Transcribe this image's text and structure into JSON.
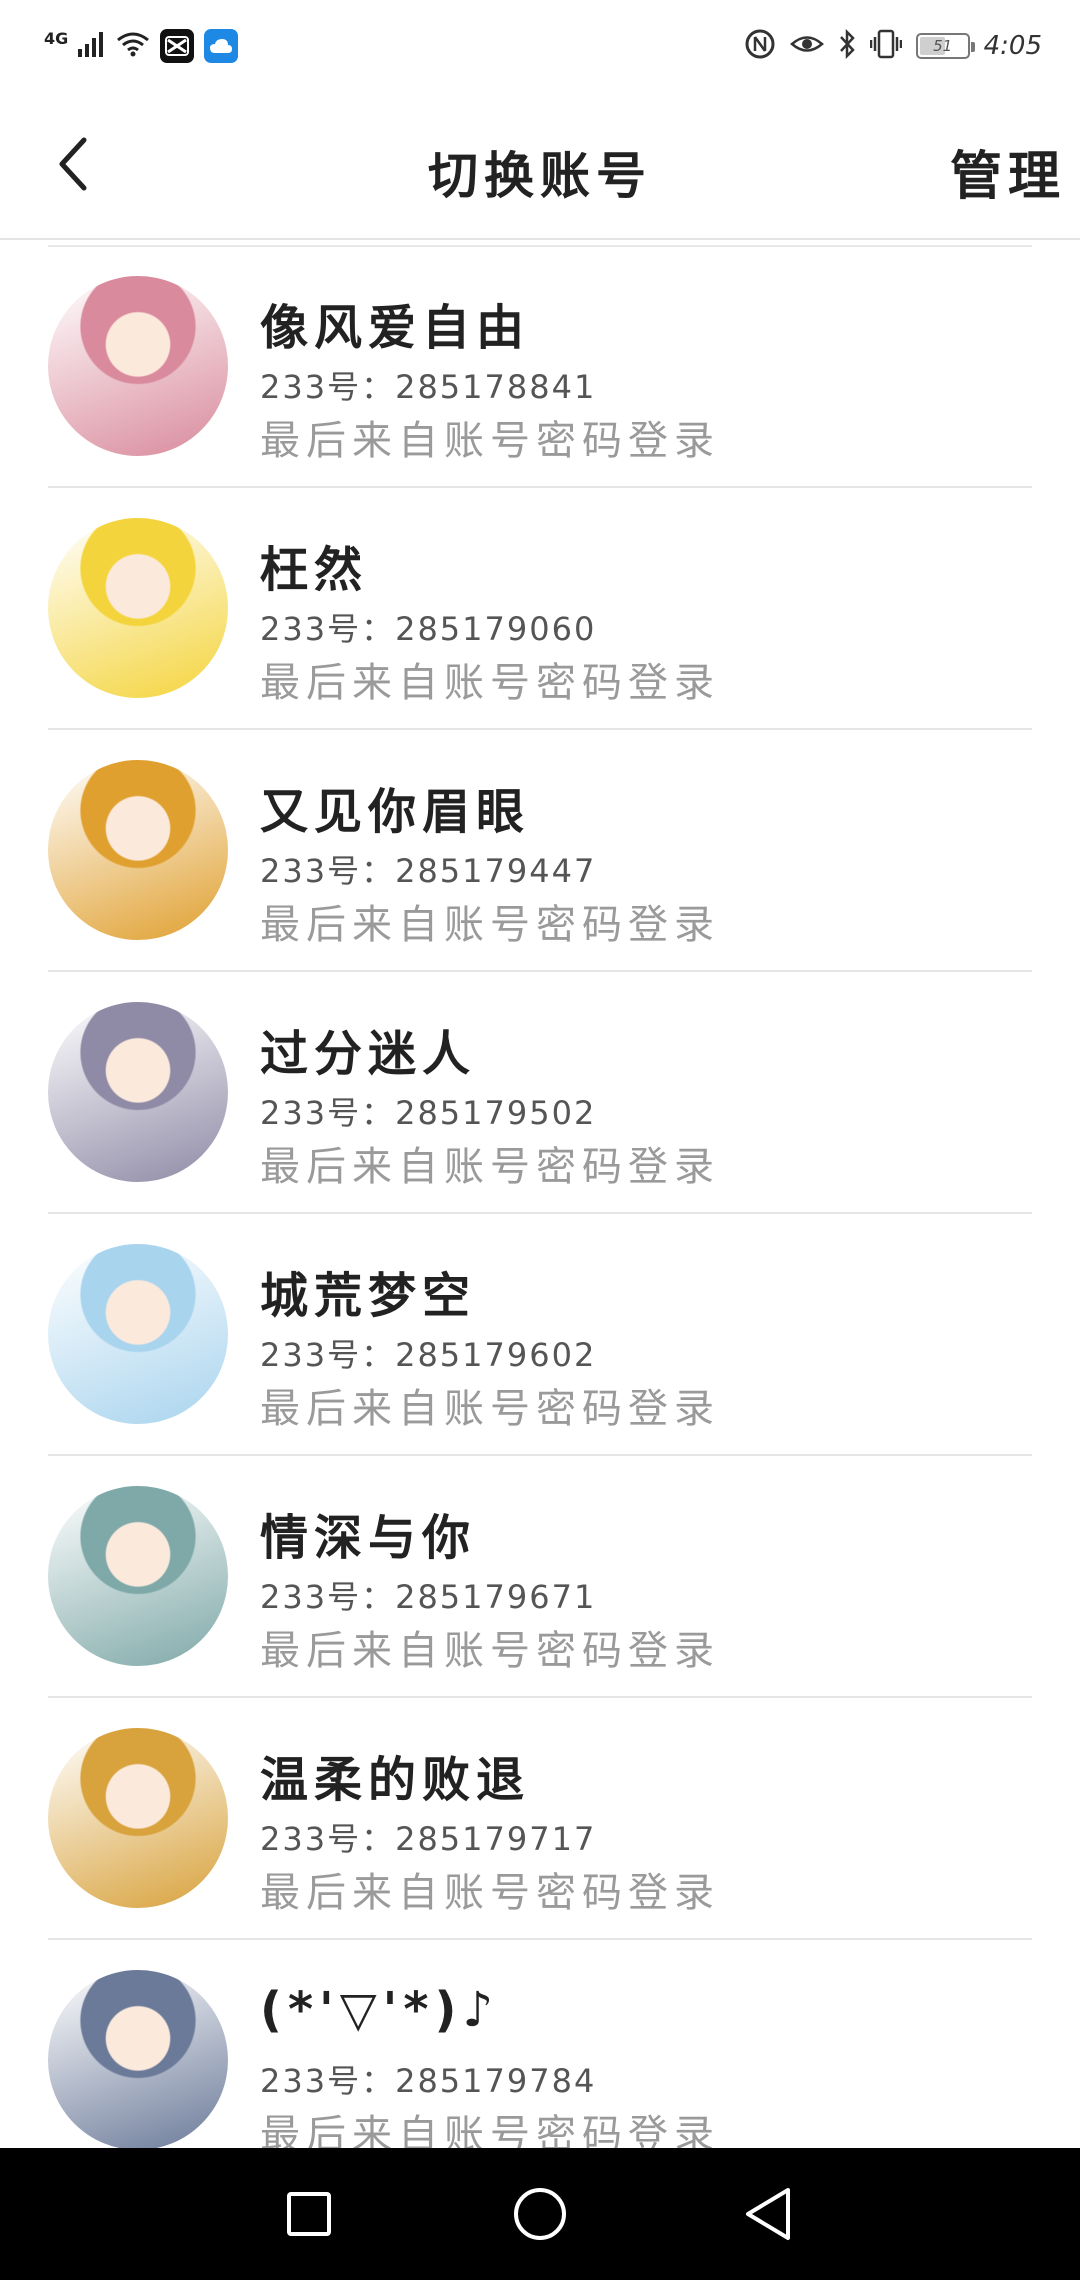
{
  "status_bar": {
    "network": "4G",
    "time": "4:05",
    "battery": "51",
    "battery_level": 0.51,
    "app_icons": [
      "capcut-icon",
      "cloud-app-icon"
    ],
    "right_icons": [
      "nfc-icon",
      "eye-icon",
      "bluetooth-icon",
      "vibrate-icon"
    ]
  },
  "header": {
    "title": "切换账号",
    "manage": "管理",
    "back_icon": "chevron-left-icon"
  },
  "accounts": [
    {
      "name": "像风爱自由",
      "id": "233号：285178841",
      "login_method": "最后来自账号密码登录",
      "avatar_color": "#d98a9c"
    },
    {
      "name": "枉然",
      "id": "233号：285179060",
      "login_method": "最后来自账号密码登录",
      "avatar_color": "#f4d43c"
    },
    {
      "name": "又见你眉眼",
      "id": "233号：285179447",
      "login_method": "最后来自账号密码登录",
      "avatar_color": "#e0a030"
    },
    {
      "name": "过分迷人",
      "id": "233号：285179502",
      "login_method": "最后来自账号密码登录",
      "avatar_color": "#8f8aa6"
    },
    {
      "name": "城荒梦空",
      "id": "233号：285179602",
      "login_method": "最后来自账号密码登录",
      "avatar_color": "#a9d4ee"
    },
    {
      "name": "情深与你",
      "id": "233号：285179671",
      "login_method": "最后来自账号密码登录",
      "avatar_color": "#7fa8a8"
    },
    {
      "name": "温柔的败退",
      "id": "233号：285179717",
      "login_method": "最后来自账号密码登录",
      "avatar_color": "#d8a23c"
    },
    {
      "name": "(*'▽'*)♪",
      "id": "233号：285179784",
      "login_method": "最后来自账号密码登录",
      "avatar_color": "#6b7a99"
    }
  ],
  "nav_bar": {
    "buttons": [
      "recents-square-icon",
      "home-circle-icon",
      "back-triangle-icon"
    ]
  }
}
